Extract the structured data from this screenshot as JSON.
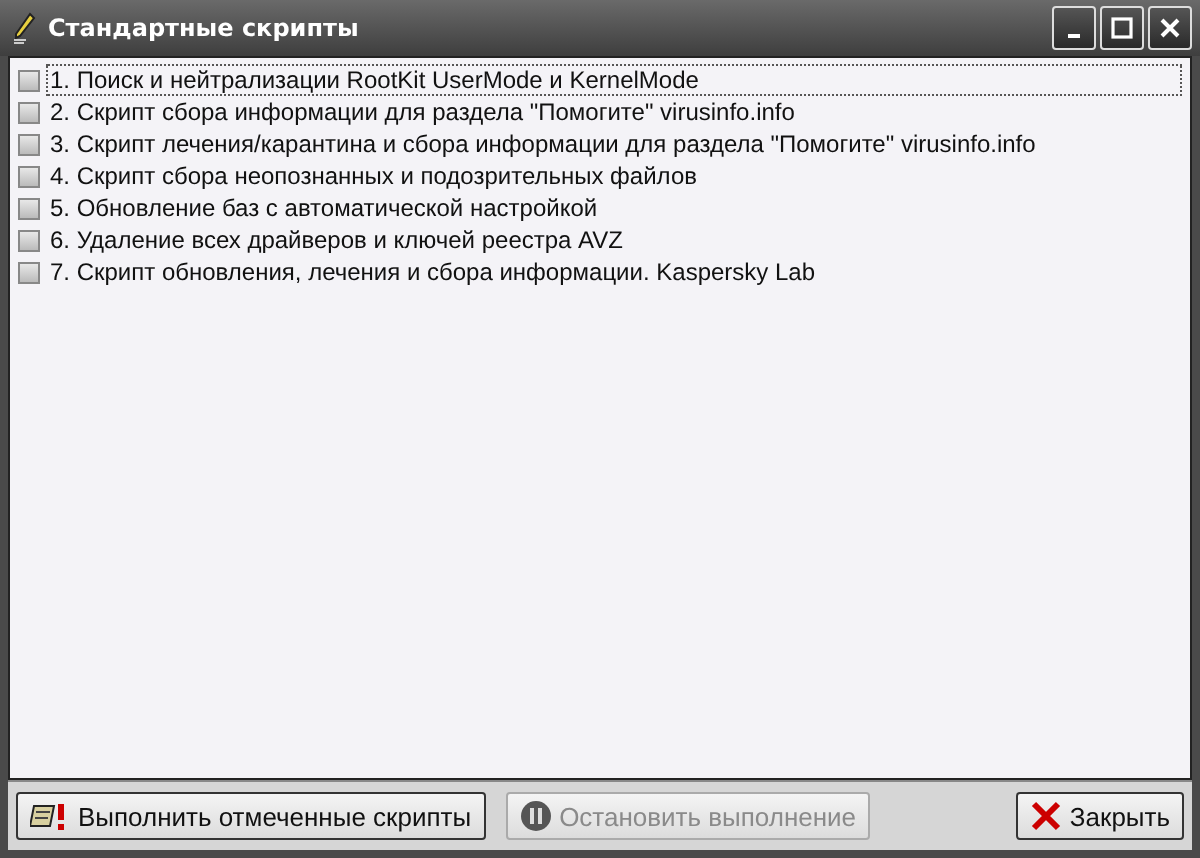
{
  "window": {
    "title": "Стандартные скрипты"
  },
  "scripts": [
    {
      "label": "1. Поиск и нейтрализации RootKit UserMode и KernelMode",
      "checked": false,
      "focused": true
    },
    {
      "label": "2. Скрипт сбора информации для раздела \"Помогите\" virusinfo.info",
      "checked": false,
      "focused": false
    },
    {
      "label": "3. Скрипт лечения/карантина и сбора информации для раздела \"Помогите\" virusinfo.info",
      "checked": false,
      "focused": false
    },
    {
      "label": "4. Скрипт сбора неопознанных и подозрительных файлов",
      "checked": false,
      "focused": false
    },
    {
      "label": "5. Обновление баз с автоматической настройкой",
      "checked": false,
      "focused": false
    },
    {
      "label": "6. Удаление всех драйверов и ключей реестра AVZ",
      "checked": false,
      "focused": false
    },
    {
      "label": "7. Скрипт обновления, лечения и сбора информации. Kaspersky Lab",
      "checked": false,
      "focused": false
    }
  ],
  "buttons": [
    {
      "label": "Выполнить отмеченные скрипты",
      "kind": "run",
      "disabled": false
    },
    {
      "label": "Остановить выполнение",
      "kind": "pause",
      "disabled": true
    },
    {
      "label": "Закрыть",
      "kind": "close",
      "disabled": false
    }
  ]
}
